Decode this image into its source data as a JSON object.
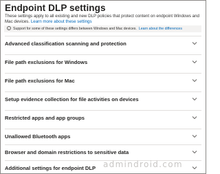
{
  "page": {
    "title": "Endpoint DLP settings",
    "description": "These settings apply to all existing and new DLP policies that protect content on endpoint Windows and Mac devices.",
    "learn_more_link": "Learn more about these settings"
  },
  "info_bar": {
    "icon": "info-icon",
    "text": "Support for some of these settings differs between Windows and Mac devices.",
    "link": "Learn about the differences"
  },
  "sections": [
    {
      "label": "Advanced classification scanning and protection",
      "icon": "chevron-down-icon"
    },
    {
      "label": "File path exclusions for Windows",
      "icon": "chevron-down-icon"
    },
    {
      "label": "File path exclusions for Mac",
      "icon": "chevron-down-icon"
    },
    {
      "label": "Setup evidence collection for file activities on devices",
      "icon": "chevron-down-icon"
    },
    {
      "label": "Restricted apps and app groups",
      "icon": "chevron-down-icon"
    },
    {
      "label": "Unallowed Bluetooth apps",
      "icon": "chevron-down-icon"
    },
    {
      "label": "Browser and domain restrictions to sensitive data",
      "icon": "chevron-down-icon"
    },
    {
      "label": "Additional settings for endpoint DLP",
      "icon": "chevron-down-icon"
    }
  ],
  "watermark": {
    "text": "admindroid.com"
  },
  "colors": {
    "link": "#0067b8",
    "divider": "#e1dfdd",
    "info_bar_bg": "#f3f2f1"
  }
}
